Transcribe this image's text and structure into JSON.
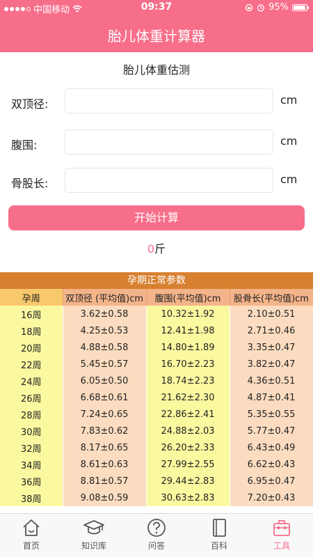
{
  "status_bar": {
    "carrier": "中国移动",
    "time": "09:37",
    "battery": "95%",
    "battery_level": 0.95
  },
  "header": {
    "title": "胎儿体重计算器"
  },
  "form": {
    "title": "胎儿体重估测",
    "fields": [
      {
        "label": "双顶径:",
        "value": "",
        "unit": "cm"
      },
      {
        "label": "腹围:",
        "value": "",
        "unit": "cm"
      },
      {
        "label": "骨股长:",
        "value": "",
        "unit": "cm"
      }
    ],
    "button_label": "开始计算",
    "result_value": "0",
    "result_unit": "斤"
  },
  "table": {
    "title": "孕期正常参数",
    "headers": [
      "孕周",
      "双顶径 (平均值)cm",
      "腹围(平均值)cm",
      "股骨长(平均值)cm"
    ],
    "rows": [
      [
        "16周",
        "3.62±0.58",
        "10.32±1.92",
        "2.10±0.51"
      ],
      [
        "18周",
        "4.25±0.53",
        "12.41±1.98",
        "2.71±0.46"
      ],
      [
        "20周",
        "4.88±0.58",
        "14.80±1.89",
        "3.35±0.47"
      ],
      [
        "22周",
        "5.45±0.57",
        "16.70±2.23",
        "3.82±0.47"
      ],
      [
        "24周",
        "6.05±0.50",
        "18.74±2.23",
        "4.36±0.51"
      ],
      [
        "26周",
        "6.68±0.61",
        "21.62±2.30",
        "4.87±0.41"
      ],
      [
        "28周",
        "7.24±0.65",
        "22.86±2.41",
        "5.35±0.55"
      ],
      [
        "30周",
        "7.83±0.62",
        "24.88±2.03",
        "5.77±0.47"
      ],
      [
        "32周",
        "8.17±0.65",
        "26.20±2.33",
        "6.43±0.49"
      ],
      [
        "34周",
        "8.61±0.63",
        "27.99±2.55",
        "6.62±0.43"
      ],
      [
        "36周",
        "8.81±0.57",
        "29.44±2.83",
        "6.95±0.47"
      ],
      [
        "38周",
        "9.08±0.59",
        "30.63±2.83",
        "7.20±0.43"
      ]
    ]
  },
  "tabbar": {
    "items": [
      {
        "label": "首页",
        "icon": "home-icon"
      },
      {
        "label": "知识库",
        "icon": "graduation-cap-icon"
      },
      {
        "label": "问答",
        "icon": "question-icon"
      },
      {
        "label": "百科",
        "icon": "book-icon"
      },
      {
        "label": "工具",
        "icon": "toolbox-icon"
      }
    ],
    "active_index": 4
  },
  "colors": {
    "primary": "#f76e8a",
    "table_title": "#d7802f",
    "yellow_col": "#fbf9a0",
    "peach_col": "#fcdcc0"
  }
}
